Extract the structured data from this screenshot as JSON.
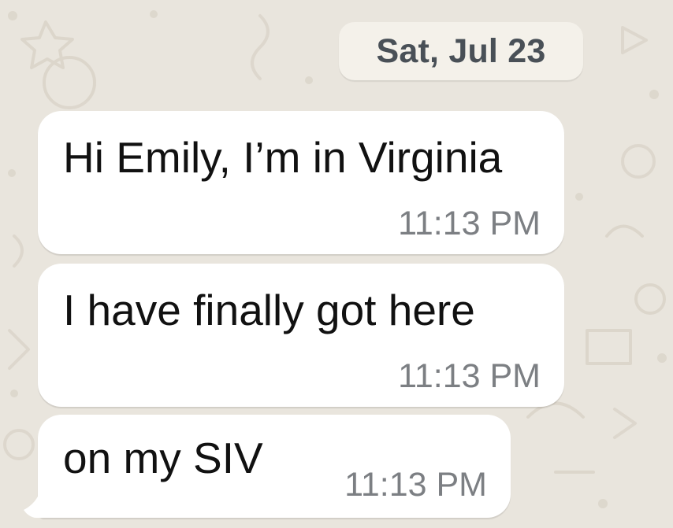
{
  "chat": {
    "date": "Sat, Jul 23",
    "messages": [
      {
        "text": "Hi Emily, I’m in Virginia",
        "time": "11:13 PM"
      },
      {
        "text": "I have finally got here",
        "time": "11:13 PM"
      },
      {
        "text": "on my SIV",
        "time": "11:13 PM"
      }
    ]
  },
  "colors": {
    "background": "#e9e5dd",
    "bubble": "#ffffff",
    "message_text": "#111111",
    "time_text": "#7c7f83",
    "date_chip": "#f4f1ea"
  }
}
